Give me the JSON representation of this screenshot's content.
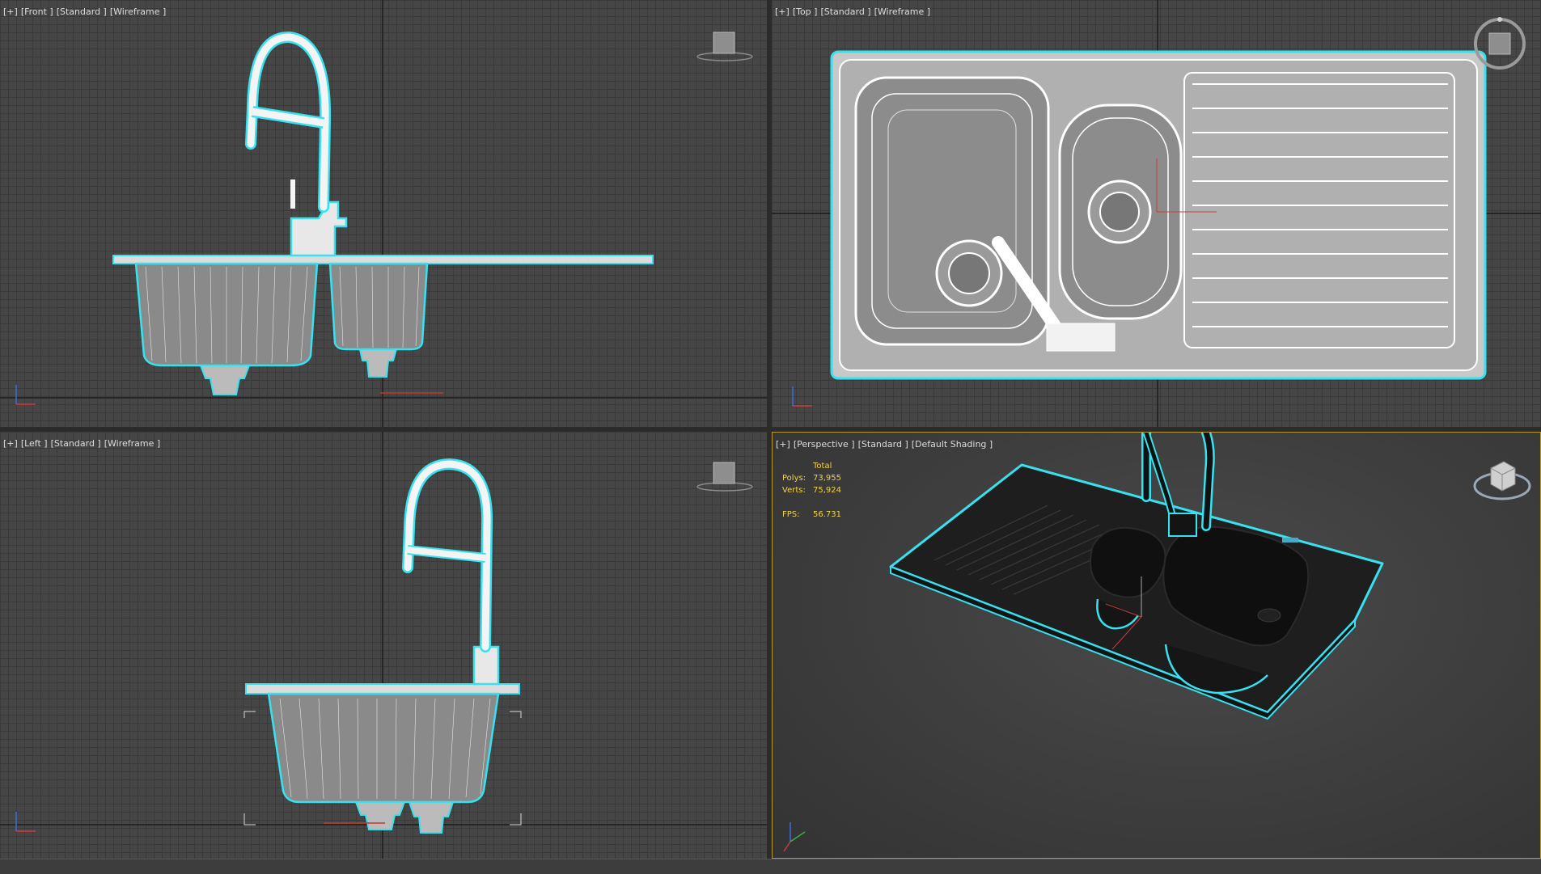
{
  "viewports": [
    {
      "id": "front",
      "labels": [
        "[+]",
        "[Front ]",
        "[Standard ]",
        "[Wireframe ]"
      ]
    },
    {
      "id": "top",
      "labels": [
        "[+]",
        "[Top ]",
        "[Standard ]",
        "[Wireframe ]"
      ]
    },
    {
      "id": "left",
      "labels": [
        "[+]",
        "[Left ]",
        "[Standard ]",
        "[Wireframe ]"
      ]
    },
    {
      "id": "perspective",
      "labels": [
        "[+]",
        "[Perspective ]",
        "[Standard ]",
        "[Default Shading ]"
      ]
    }
  ],
  "stats": {
    "header": "Total",
    "polys_label": "Polys:",
    "polys": "73,955",
    "verts_label": "Verts:",
    "verts": "75,924",
    "fps_label": "FPS:",
    "fps": "56.731"
  },
  "colors": {
    "selection_outline": "#36e2f0",
    "wire": "#ffffff",
    "stats_text": "#f0d44a",
    "active_border": "#b89a2c"
  },
  "icons": [
    "viewcube-icon",
    "axis-tripod-icon",
    "compass-ring-icon"
  ]
}
